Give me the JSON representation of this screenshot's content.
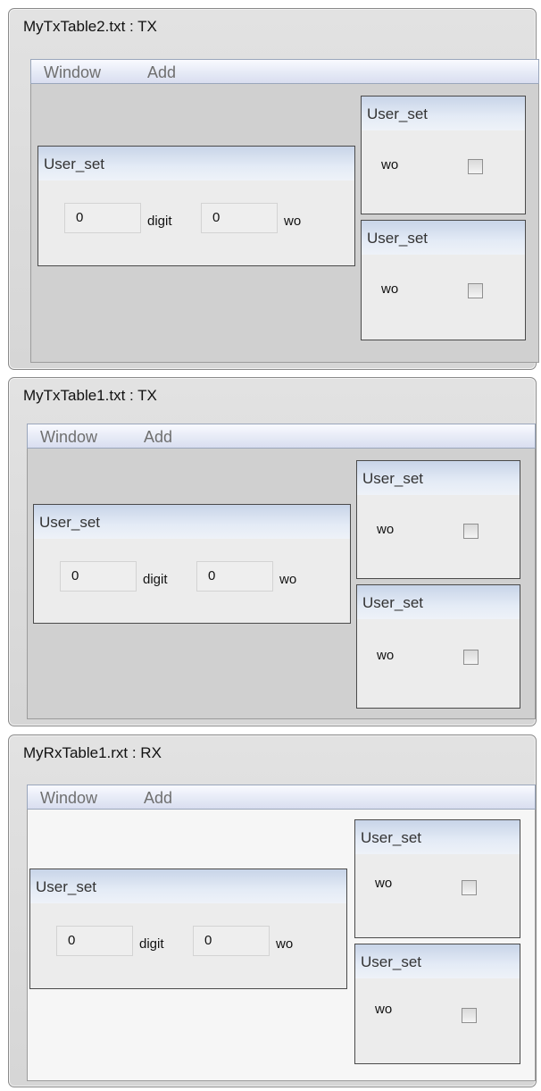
{
  "windows": [
    {
      "title": "MyTxTable2.txt : TX",
      "menu": [
        "Window",
        "Add"
      ],
      "main_panel": {
        "title": "User_set",
        "value1": "0",
        "label1": "digit",
        "value2": "0",
        "label2": "wo"
      },
      "side_panels": [
        {
          "title": "User_set",
          "label": "wo",
          "checked": false
        },
        {
          "title": "User_set",
          "label": "wo",
          "checked": false
        }
      ]
    },
    {
      "title": "MyTxTable1.txt : TX",
      "menu": [
        "Window",
        "Add"
      ],
      "main_panel": {
        "title": "User_set",
        "value1": "0",
        "label1": "digit",
        "value2": "0",
        "label2": "wo"
      },
      "side_panels": [
        {
          "title": "User_set",
          "label": "wo",
          "checked": false
        },
        {
          "title": "User_set",
          "label": "wo",
          "checked": false
        }
      ]
    },
    {
      "title": "MyRxTable1.rxt : RX",
      "menu": [
        "Window",
        "Add"
      ],
      "main_panel": {
        "title": "User_set",
        "value1": "0",
        "label1": "digit",
        "value2": "0",
        "label2": "wo"
      },
      "side_panels": [
        {
          "title": "User_set",
          "label": "wo",
          "checked": false
        },
        {
          "title": "User_set",
          "label": "wo",
          "checked": false
        }
      ]
    }
  ]
}
